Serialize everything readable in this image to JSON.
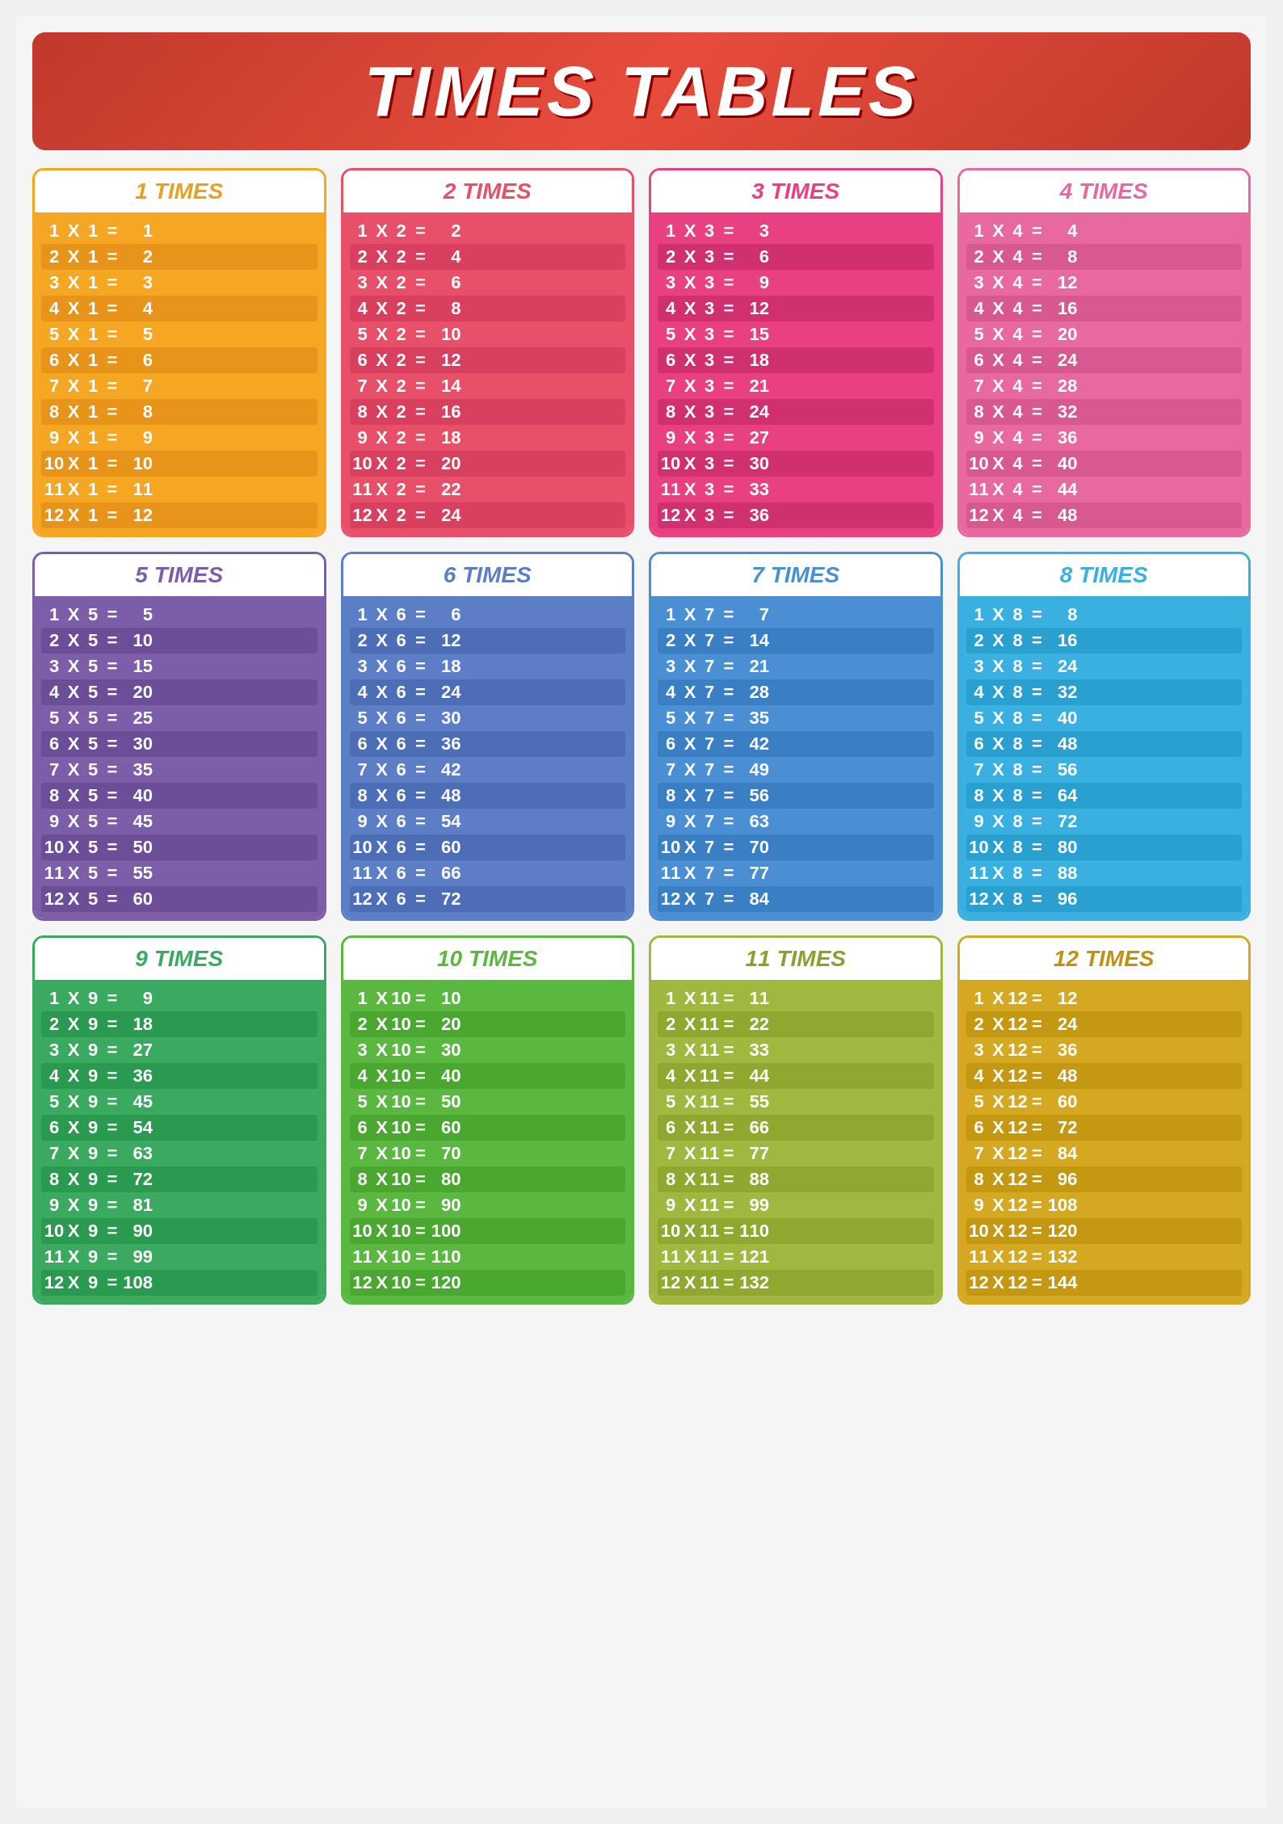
{
  "title": "TIMES TABLES",
  "tables": [
    {
      "id": 1,
      "label": "1 TIMES",
      "multiplier": 1,
      "rows": [
        {
          "n": 1,
          "m": 1,
          "r": 1
        },
        {
          "n": 2,
          "m": 1,
          "r": 2
        },
        {
          "n": 3,
          "m": 1,
          "r": 3
        },
        {
          "n": 4,
          "m": 1,
          "r": 4
        },
        {
          "n": 5,
          "m": 1,
          "r": 5
        },
        {
          "n": 6,
          "m": 1,
          "r": 6
        },
        {
          "n": 7,
          "m": 1,
          "r": 7
        },
        {
          "n": 8,
          "m": 1,
          "r": 8
        },
        {
          "n": 9,
          "m": 1,
          "r": 9
        },
        {
          "n": 10,
          "m": 1,
          "r": 10
        },
        {
          "n": 11,
          "m": 1,
          "r": 11
        },
        {
          "n": 12,
          "m": 1,
          "r": 12
        }
      ]
    },
    {
      "id": 2,
      "label": "2 TIMES",
      "multiplier": 2,
      "rows": [
        {
          "n": 1,
          "m": 2,
          "r": 2
        },
        {
          "n": 2,
          "m": 2,
          "r": 4
        },
        {
          "n": 3,
          "m": 2,
          "r": 6
        },
        {
          "n": 4,
          "m": 2,
          "r": 8
        },
        {
          "n": 5,
          "m": 2,
          "r": 10
        },
        {
          "n": 6,
          "m": 2,
          "r": 12
        },
        {
          "n": 7,
          "m": 2,
          "r": 14
        },
        {
          "n": 8,
          "m": 2,
          "r": 16
        },
        {
          "n": 9,
          "m": 2,
          "r": 18
        },
        {
          "n": 10,
          "m": 2,
          "r": 20
        },
        {
          "n": 11,
          "m": 2,
          "r": 22
        },
        {
          "n": 12,
          "m": 2,
          "r": 24
        }
      ]
    },
    {
      "id": 3,
      "label": "3 TIMES",
      "multiplier": 3,
      "rows": [
        {
          "n": 1,
          "m": 3,
          "r": 3
        },
        {
          "n": 2,
          "m": 3,
          "r": 6
        },
        {
          "n": 3,
          "m": 3,
          "r": 9
        },
        {
          "n": 4,
          "m": 3,
          "r": 12
        },
        {
          "n": 5,
          "m": 3,
          "r": 15
        },
        {
          "n": 6,
          "m": 3,
          "r": 18
        },
        {
          "n": 7,
          "m": 3,
          "r": 21
        },
        {
          "n": 8,
          "m": 3,
          "r": 24
        },
        {
          "n": 9,
          "m": 3,
          "r": 27
        },
        {
          "n": 10,
          "m": 3,
          "r": 30
        },
        {
          "n": 11,
          "m": 3,
          "r": 33
        },
        {
          "n": 12,
          "m": 3,
          "r": 36
        }
      ]
    },
    {
      "id": 4,
      "label": "4 TIMES",
      "multiplier": 4,
      "rows": [
        {
          "n": 1,
          "m": 4,
          "r": 4
        },
        {
          "n": 2,
          "m": 4,
          "r": 8
        },
        {
          "n": 3,
          "m": 4,
          "r": 12
        },
        {
          "n": 4,
          "m": 4,
          "r": 16
        },
        {
          "n": 5,
          "m": 4,
          "r": 20
        },
        {
          "n": 6,
          "m": 4,
          "r": 24
        },
        {
          "n": 7,
          "m": 4,
          "r": 28
        },
        {
          "n": 8,
          "m": 4,
          "r": 32
        },
        {
          "n": 9,
          "m": 4,
          "r": 36
        },
        {
          "n": 10,
          "m": 4,
          "r": 40
        },
        {
          "n": 11,
          "m": 4,
          "r": 44
        },
        {
          "n": 12,
          "m": 4,
          "r": 48
        }
      ]
    },
    {
      "id": 5,
      "label": "5 TIMES",
      "multiplier": 5,
      "rows": [
        {
          "n": 1,
          "m": 5,
          "r": 5
        },
        {
          "n": 2,
          "m": 5,
          "r": 10
        },
        {
          "n": 3,
          "m": 5,
          "r": 15
        },
        {
          "n": 4,
          "m": 5,
          "r": 20
        },
        {
          "n": 5,
          "m": 5,
          "r": 25
        },
        {
          "n": 6,
          "m": 5,
          "r": 30
        },
        {
          "n": 7,
          "m": 5,
          "r": 35
        },
        {
          "n": 8,
          "m": 5,
          "r": 40
        },
        {
          "n": 9,
          "m": 5,
          "r": 45
        },
        {
          "n": 10,
          "m": 5,
          "r": 50
        },
        {
          "n": 11,
          "m": 5,
          "r": 55
        },
        {
          "n": 12,
          "m": 5,
          "r": 60
        }
      ]
    },
    {
      "id": 6,
      "label": "6 TIMES",
      "multiplier": 6,
      "rows": [
        {
          "n": 1,
          "m": 6,
          "r": 6
        },
        {
          "n": 2,
          "m": 6,
          "r": 12
        },
        {
          "n": 3,
          "m": 6,
          "r": 18
        },
        {
          "n": 4,
          "m": 6,
          "r": 24
        },
        {
          "n": 5,
          "m": 6,
          "r": 30
        },
        {
          "n": 6,
          "m": 6,
          "r": 36
        },
        {
          "n": 7,
          "m": 6,
          "r": 42
        },
        {
          "n": 8,
          "m": 6,
          "r": 48
        },
        {
          "n": 9,
          "m": 6,
          "r": 54
        },
        {
          "n": 10,
          "m": 6,
          "r": 60
        },
        {
          "n": 11,
          "m": 6,
          "r": 66
        },
        {
          "n": 12,
          "m": 6,
          "r": 72
        }
      ]
    },
    {
      "id": 7,
      "label": "7 TIMES",
      "multiplier": 7,
      "rows": [
        {
          "n": 1,
          "m": 7,
          "r": 7
        },
        {
          "n": 2,
          "m": 7,
          "r": 14
        },
        {
          "n": 3,
          "m": 7,
          "r": 21
        },
        {
          "n": 4,
          "m": 7,
          "r": 28
        },
        {
          "n": 5,
          "m": 7,
          "r": 35
        },
        {
          "n": 6,
          "m": 7,
          "r": 42
        },
        {
          "n": 7,
          "m": 7,
          "r": 49
        },
        {
          "n": 8,
          "m": 7,
          "r": 56
        },
        {
          "n": 9,
          "m": 7,
          "r": 63
        },
        {
          "n": 10,
          "m": 7,
          "r": 70
        },
        {
          "n": 11,
          "m": 7,
          "r": 77
        },
        {
          "n": 12,
          "m": 7,
          "r": 84
        }
      ]
    },
    {
      "id": 8,
      "label": "8 TIMES",
      "multiplier": 8,
      "rows": [
        {
          "n": 1,
          "m": 8,
          "r": 8
        },
        {
          "n": 2,
          "m": 8,
          "r": 16
        },
        {
          "n": 3,
          "m": 8,
          "r": 24
        },
        {
          "n": 4,
          "m": 8,
          "r": 32
        },
        {
          "n": 5,
          "m": 8,
          "r": 40
        },
        {
          "n": 6,
          "m": 8,
          "r": 48
        },
        {
          "n": 7,
          "m": 8,
          "r": 56
        },
        {
          "n": 8,
          "m": 8,
          "r": 64
        },
        {
          "n": 9,
          "m": 8,
          "r": 72
        },
        {
          "n": 10,
          "m": 8,
          "r": 80
        },
        {
          "n": 11,
          "m": 8,
          "r": 88
        },
        {
          "n": 12,
          "m": 8,
          "r": 96
        }
      ]
    },
    {
      "id": 9,
      "label": "9 TIMES",
      "multiplier": 9,
      "rows": [
        {
          "n": 1,
          "m": 9,
          "r": 9
        },
        {
          "n": 2,
          "m": 9,
          "r": 18
        },
        {
          "n": 3,
          "m": 9,
          "r": 27
        },
        {
          "n": 4,
          "m": 9,
          "r": 36
        },
        {
          "n": 5,
          "m": 9,
          "r": 45
        },
        {
          "n": 6,
          "m": 9,
          "r": 54
        },
        {
          "n": 7,
          "m": 9,
          "r": 63
        },
        {
          "n": 8,
          "m": 9,
          "r": 72
        },
        {
          "n": 9,
          "m": 9,
          "r": 81
        },
        {
          "n": 10,
          "m": 9,
          "r": 90
        },
        {
          "n": 11,
          "m": 9,
          "r": 99
        },
        {
          "n": 12,
          "m": 9,
          "r": 108
        }
      ]
    },
    {
      "id": 10,
      "label": "10 TIMES",
      "multiplier": 10,
      "rows": [
        {
          "n": 1,
          "m": 10,
          "r": 10
        },
        {
          "n": 2,
          "m": 10,
          "r": 20
        },
        {
          "n": 3,
          "m": 10,
          "r": 30
        },
        {
          "n": 4,
          "m": 10,
          "r": 40
        },
        {
          "n": 5,
          "m": 10,
          "r": 50
        },
        {
          "n": 6,
          "m": 10,
          "r": 60
        },
        {
          "n": 7,
          "m": 10,
          "r": 70
        },
        {
          "n": 8,
          "m": 10,
          "r": 80
        },
        {
          "n": 9,
          "m": 10,
          "r": 90
        },
        {
          "n": 10,
          "m": 10,
          "r": 100
        },
        {
          "n": 11,
          "m": 10,
          "r": 110
        },
        {
          "n": 12,
          "m": 10,
          "r": 120
        }
      ]
    },
    {
      "id": 11,
      "label": "11 TIMES",
      "multiplier": 11,
      "rows": [
        {
          "n": 1,
          "m": 11,
          "r": 11
        },
        {
          "n": 2,
          "m": 11,
          "r": 22
        },
        {
          "n": 3,
          "m": 11,
          "r": 33
        },
        {
          "n": 4,
          "m": 11,
          "r": 44
        },
        {
          "n": 5,
          "m": 11,
          "r": 55
        },
        {
          "n": 6,
          "m": 11,
          "r": 66
        },
        {
          "n": 7,
          "m": 11,
          "r": 77
        },
        {
          "n": 8,
          "m": 11,
          "r": 88
        },
        {
          "n": 9,
          "m": 11,
          "r": 99
        },
        {
          "n": 10,
          "m": 11,
          "r": 110
        },
        {
          "n": 11,
          "m": 11,
          "r": 121
        },
        {
          "n": 12,
          "m": 11,
          "r": 132
        }
      ]
    },
    {
      "id": 12,
      "label": "12 TIMES",
      "multiplier": 12,
      "rows": [
        {
          "n": 1,
          "m": 12,
          "r": 12
        },
        {
          "n": 2,
          "m": 12,
          "r": 24
        },
        {
          "n": 3,
          "m": 12,
          "r": 36
        },
        {
          "n": 4,
          "m": 12,
          "r": 48
        },
        {
          "n": 5,
          "m": 12,
          "r": 60
        },
        {
          "n": 6,
          "m": 12,
          "r": 72
        },
        {
          "n": 7,
          "m": 12,
          "r": 84
        },
        {
          "n": 8,
          "m": 12,
          "r": 96
        },
        {
          "n": 9,
          "m": 12,
          "r": 108
        },
        {
          "n": 10,
          "m": 12,
          "r": 120
        },
        {
          "n": 11,
          "m": 12,
          "r": 132
        },
        {
          "n": 12,
          "m": 12,
          "r": 144
        }
      ]
    }
  ]
}
